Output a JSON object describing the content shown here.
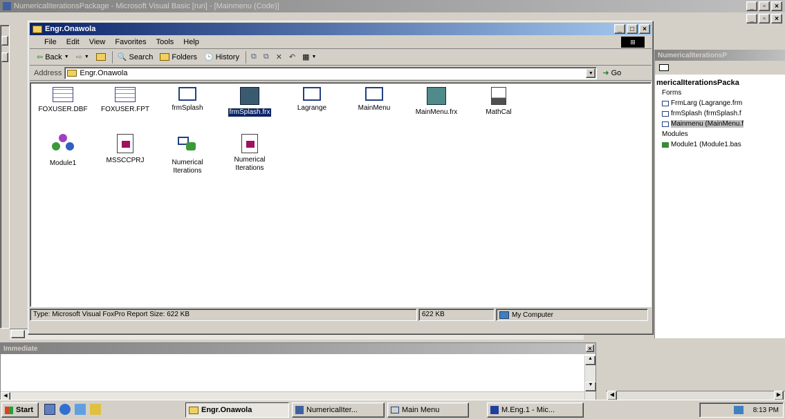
{
  "vb_window": {
    "title": "NumericalIterationsPackage - Microsoft Visual Basic [run] - [Mainmenu (Code)]"
  },
  "project_panel": {
    "title": "NumericalIterationsP",
    "root": "mericalIterationsPacka",
    "folders": {
      "forms": "Forms",
      "modules": "Modules"
    },
    "items": [
      {
        "label": "FrmLarg (Lagrange.frm"
      },
      {
        "label": "frmSplash (frmSplash.f"
      },
      {
        "label": "Mainmenu (MainMenu.f"
      },
      {
        "label": "Module1 (Module1.bas"
      }
    ]
  },
  "immediate": {
    "title": "Immediate"
  },
  "explorer": {
    "title": "Engr.Onawola",
    "menu": [
      "File",
      "Edit",
      "View",
      "Favorites",
      "Tools",
      "Help"
    ],
    "toolbar": {
      "back": "Back",
      "search": "Search",
      "folders": "Folders",
      "history": "History"
    },
    "address_label": "Address",
    "address_value": "Engr.Onawola",
    "go": "Go",
    "files": [
      {
        "name": "FOXUSER.DBF",
        "icon": "table-icon"
      },
      {
        "name": "FOXUSER.FPT",
        "icon": "table-icon"
      },
      {
        "name": "frmSplash",
        "icon": "form-icon"
      },
      {
        "name": "frmSplash.frx",
        "icon": "frx-icon",
        "selected": true
      },
      {
        "name": "Lagrange",
        "icon": "form-icon"
      },
      {
        "name": "MainMenu",
        "icon": "form-icon"
      },
      {
        "name": "MainMenu.frx",
        "icon": "frx-icon"
      },
      {
        "name": "MathCal",
        "icon": "document-icon"
      },
      {
        "name": "Module1",
        "icon": "module-icon"
      },
      {
        "name": "MSSCCPRJ",
        "icon": "scc-icon"
      },
      {
        "name": "Numerical Iterations",
        "icon": "project-icon"
      },
      {
        "name": "Numerical Iterations",
        "icon": "scc-icon"
      }
    ],
    "status": {
      "type": "Type: Microsoft Visual FoxPro Report Size: 622 KB",
      "size": "622 KB",
      "zone": "My Computer"
    }
  },
  "taskbar": {
    "start": "Start",
    "tasks": [
      {
        "label": "Engr.Onawola",
        "active": true
      },
      {
        "label": "NumericalIter..."
      },
      {
        "label": "Main Menu"
      },
      {
        "label": "M.Eng.1 - Mic..."
      }
    ],
    "clock": "8:13 PM"
  },
  "colors": {
    "title_active": "#0a246a",
    "title_inactive": "#808080",
    "face": "#d4d0c8"
  }
}
